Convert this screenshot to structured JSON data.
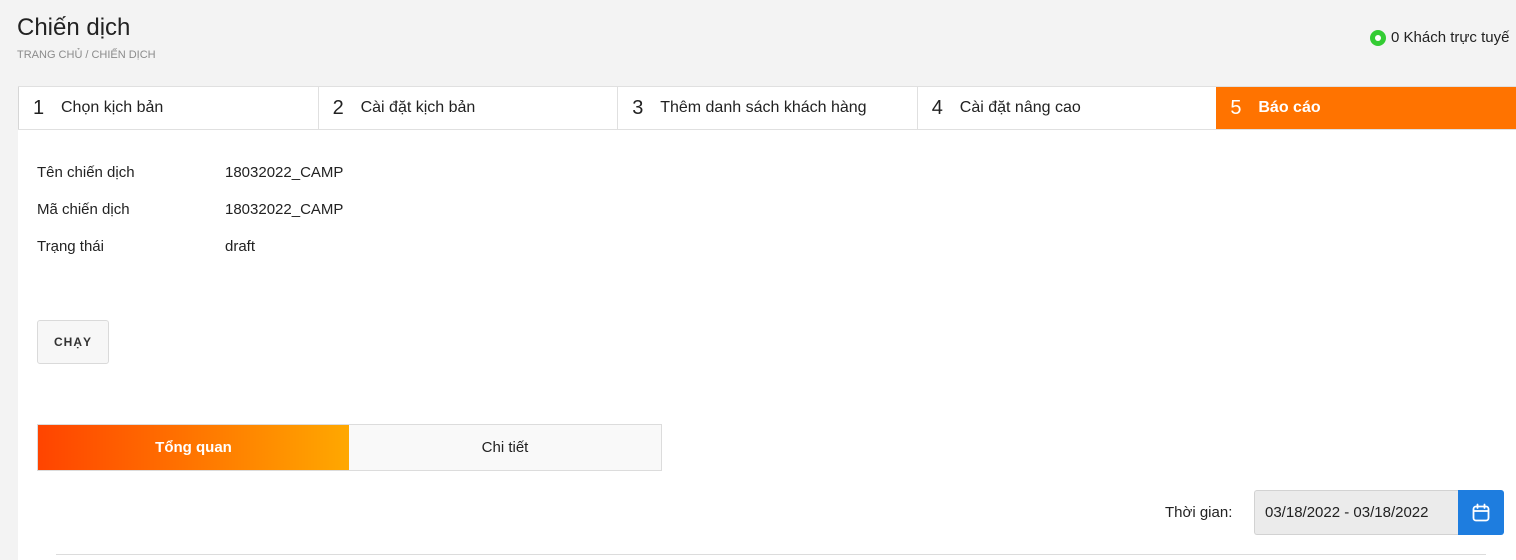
{
  "header": {
    "title": "Chiến dịch",
    "breadcrumb": [
      "TRANG CHỦ",
      "CHIẾN DỊCH"
    ],
    "online_status": "0 Khách trực tuyế",
    "status_color": "#33cc33"
  },
  "steps": [
    {
      "number": "1",
      "label": "Chọn kịch bản",
      "active": false
    },
    {
      "number": "2",
      "label": "Cài đặt kịch bản",
      "active": false
    },
    {
      "number": "3",
      "label": "Thêm danh sách khách hàng",
      "active": false
    },
    {
      "number": "4",
      "label": "Cài đặt nâng cao",
      "active": false
    },
    {
      "number": "5",
      "label": "Báo cáo",
      "active": true
    }
  ],
  "campaign": {
    "name_label": "Tên chiến dịch",
    "name_value": "18032022_CAMP",
    "code_label": "Mã chiến dịch",
    "code_value": "18032022_CAMP",
    "status_label": "Trạng thái",
    "status_value": "draft"
  },
  "actions": {
    "run_label": "CHẠY"
  },
  "tabs": {
    "overview": "Tổng quan",
    "detail": "Chi tiết",
    "active": "overview"
  },
  "filter": {
    "time_label": "Thời gian:",
    "date_range": "03/18/2022 - 03/18/2022",
    "calendar_icon": "calendar-icon"
  },
  "colors": {
    "accent": "#ff7300",
    "primary_button": "#1e7ddf"
  }
}
